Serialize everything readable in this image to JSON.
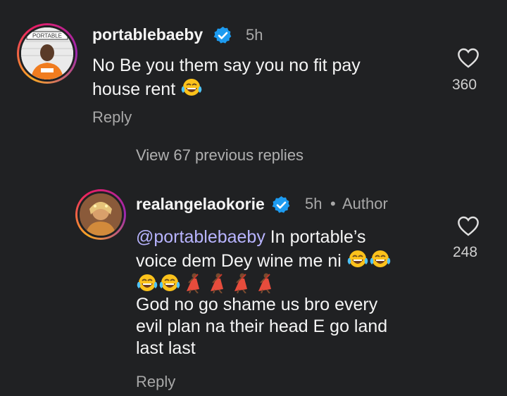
{
  "comment1": {
    "username": "portablebaeby",
    "time": "5h",
    "text_line1": "No Be you them say you no fit pay",
    "text_line2": "house rent",
    "emoji1": "laughing-tears",
    "likes": "360",
    "reply_label": "Reply",
    "avatar_text": "PORTABLE"
  },
  "view_replies": "View 67 previous replies",
  "comment2": {
    "username": "realangelaokorie",
    "time": "5h",
    "separator": "•",
    "author_label": "Author",
    "mention": "@portablebaeby",
    "text_line1_rest": " In portable’s",
    "text_line2": "voice dem Dey wine me ni",
    "text_line4": "God no go shame us bro every",
    "text_line5": "evil plan na their head E go land",
    "text_line6": "last last",
    "likes": "248",
    "reply_label": "Reply"
  },
  "colors": {
    "background": "#202123",
    "verified": "#1d9bf0",
    "mention": "#b8b4ff",
    "muted": "#a8a8a8"
  }
}
